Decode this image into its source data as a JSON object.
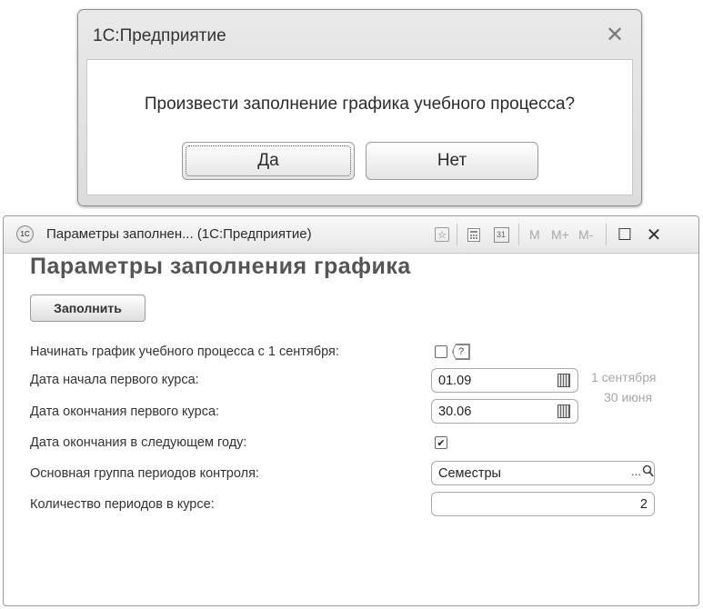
{
  "dialog": {
    "title": "1С:Предприятие",
    "close_glyph": "✕",
    "question": "Произвести заполнение графика учебного процесса?",
    "yes_label": "Да",
    "no_label": "Нет"
  },
  "window": {
    "app_icon_text": "1С",
    "title": "Параметры заполнен... (1С:Предприятие)",
    "toolbar": {
      "favorite_icon": "☆",
      "calculator_icon": "calculator-icon",
      "calendar_icon_text": "31",
      "m_label": "M",
      "m_plus_label": "M+",
      "m_minus_label": "M-",
      "maximize_glyph": "☐",
      "close_glyph": "✕"
    }
  },
  "form": {
    "title": "Параметры заполнения графика",
    "fill_button": "Заполнить",
    "start_sept_label": "Начинать график учебного процесса с 1 сентября:",
    "help_glyph": "?",
    "start_date_label": "Дата начала первого курса:",
    "start_date_value": "01.09",
    "start_date_hint": "1 сентября",
    "end_date_label": "Дата окончания первого курса:",
    "end_date_value": "30.06",
    "end_date_hint": "30 июня",
    "end_next_year_label": "Дата окончания в следующем году:",
    "end_next_year_checked": true,
    "check_glyph": "✔",
    "control_group_label": "Основная группа периодов контроля:",
    "control_group_value": "Семестры",
    "select_glyph": "...",
    "search_glyph": "🔍",
    "periods_label": "Количество периодов в курсе:",
    "periods_value": "2"
  }
}
